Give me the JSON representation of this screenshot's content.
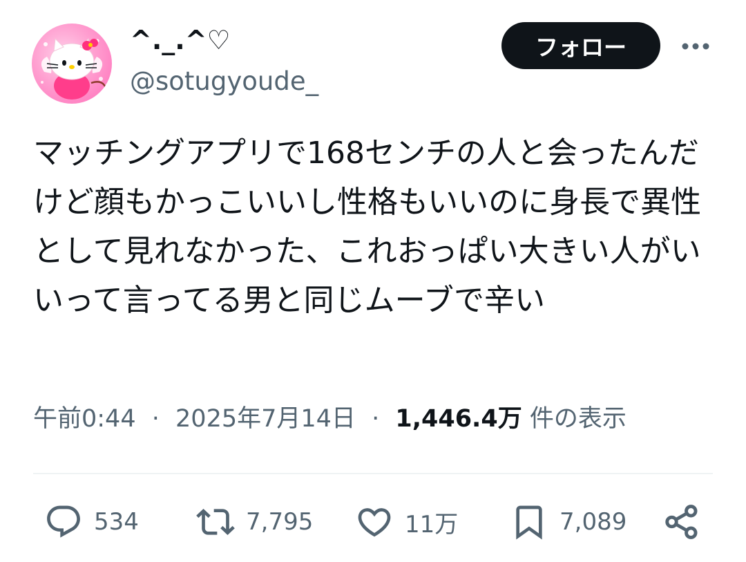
{
  "user": {
    "display_name": "^._.^♡",
    "handle": "@sotugyoude_",
    "avatar_icon": "hello-kitty-angel-avatar"
  },
  "header": {
    "follow_label": "フォロー",
    "more_icon": "more-icon"
  },
  "tweet": {
    "text": "マッチングアプリで168センチの人と会ったんだけど顔もかっこいいし性格もいいのに身長で異性として見れなかった、これおっぱい大きい人がいいって言ってる男と同じムーブで辛い"
  },
  "meta": {
    "time": "午前0:44",
    "separator": "·",
    "date": "2025年7月14日",
    "views_count": "1,446.4万",
    "views_label": "件の表示"
  },
  "actions": {
    "reply_count": "534",
    "retweet_count": "7,795",
    "like_count": "11万",
    "bookmark_count": "7,089"
  },
  "colors": {
    "text_primary": "#0f1419",
    "text_secondary": "#536471",
    "divider": "#eff3f4",
    "follow_bg": "#0f1419"
  }
}
